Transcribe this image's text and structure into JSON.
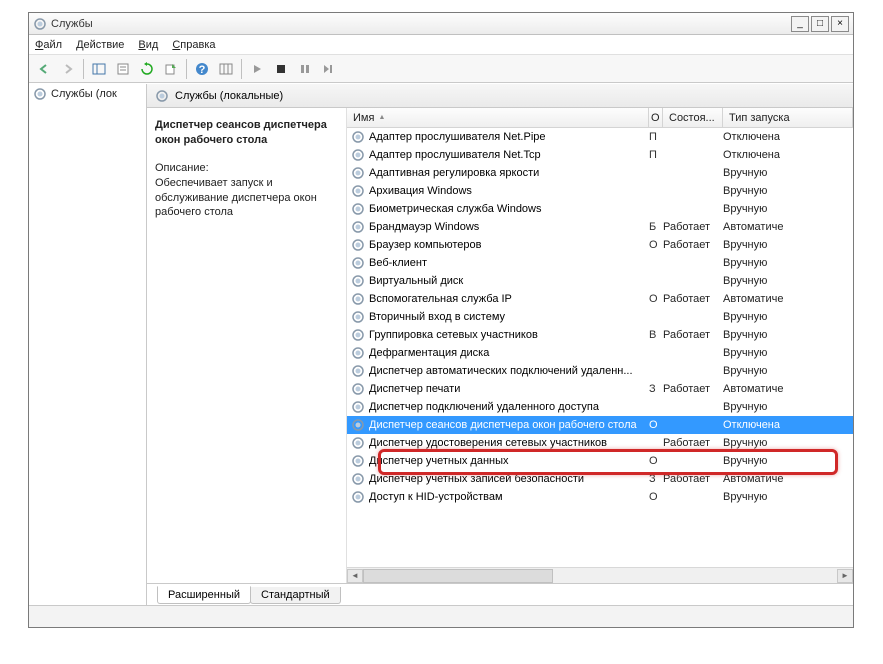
{
  "window": {
    "title": "Службы"
  },
  "menu": {
    "file": "Файл",
    "action": "Действие",
    "view": "Вид",
    "help": "Справка"
  },
  "left": {
    "node": "Службы (лок"
  },
  "header": {
    "title": "Службы (локальные)"
  },
  "desc": {
    "name": "Диспетчер сеансов диспетчера окон рабочего стола",
    "label": "Описание:",
    "text": "Обеспечивает запуск и обслуживание диспетчера окон рабочего стола"
  },
  "columns": {
    "name": "Имя",
    "desc": "О",
    "status": "Состоя...",
    "start": "Тип запуска"
  },
  "services": [
    {
      "name": "Адаптер прослушивателя Net.Pipe",
      "d": "П",
      "status": "",
      "start": "Отключена"
    },
    {
      "name": "Адаптер прослушивателя Net.Tcp",
      "d": "П",
      "status": "",
      "start": "Отключена"
    },
    {
      "name": "Адаптивная регулировка яркости",
      "d": "",
      "status": "",
      "start": "Вручную"
    },
    {
      "name": "Архивация Windows",
      "d": "",
      "status": "",
      "start": "Вручную"
    },
    {
      "name": "Биометрическая служба Windows",
      "d": "",
      "status": "",
      "start": "Вручную"
    },
    {
      "name": "Брандмауэр Windows",
      "d": "Б",
      "status": "Работает",
      "start": "Автоматиче"
    },
    {
      "name": "Браузер компьютеров",
      "d": "О",
      "status": "Работает",
      "start": "Вручную"
    },
    {
      "name": "Веб-клиент",
      "d": "",
      "status": "",
      "start": "Вручную"
    },
    {
      "name": "Виртуальный диск",
      "d": "",
      "status": "",
      "start": "Вручную"
    },
    {
      "name": "Вспомогательная служба IP",
      "d": "О",
      "status": "Работает",
      "start": "Автоматиче"
    },
    {
      "name": "Вторичный вход в систему",
      "d": "",
      "status": "",
      "start": "Вручную"
    },
    {
      "name": "Группировка сетевых участников",
      "d": "В",
      "status": "Работает",
      "start": "Вручную"
    },
    {
      "name": "Дефрагментация диска",
      "d": "",
      "status": "",
      "start": "Вручную"
    },
    {
      "name": "Диспетчер автоматических подключений удаленн...",
      "d": "",
      "status": "",
      "start": "Вручную"
    },
    {
      "name": "Диспетчер печати",
      "d": "З",
      "status": "Работает",
      "start": "Автоматиче"
    },
    {
      "name": "Диспетчер подключений удаленного доступа",
      "d": "",
      "status": "",
      "start": "Вручную"
    },
    {
      "name": "Диспетчер сеансов диспетчера окон рабочего стола",
      "d": "О",
      "status": "",
      "start": "Отключена",
      "sel": true
    },
    {
      "name": "Диспетчер удостоверения сетевых участников",
      "d": "",
      "status": "Работает",
      "start": "Вручную"
    },
    {
      "name": "Диспетчер учетных данных",
      "d": "О",
      "status": "",
      "start": "Вручную"
    },
    {
      "name": "Диспетчер учетных записей безопасности",
      "d": "З",
      "status": "Работает",
      "start": "Автоматиче"
    },
    {
      "name": "Доступ к HID-устройствам",
      "d": "О",
      "status": "",
      "start": "Вручную"
    }
  ],
  "tabs": {
    "extended": "Расширенный",
    "standard": "Стандартный"
  }
}
